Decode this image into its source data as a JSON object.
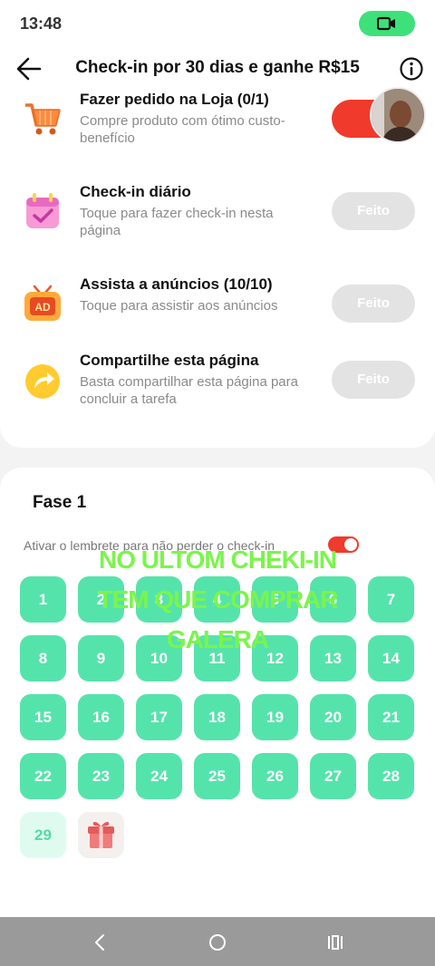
{
  "status_bar": {
    "time": "13:48",
    "record_icon": "video-camera-icon",
    "accent": "#3ee07a"
  },
  "header": {
    "title": "Check-in por 30 dias e ganhe R$15",
    "back_icon": "arrow-left-icon",
    "info_icon": "info-icon"
  },
  "tasks": [
    {
      "title": "Fazer pedido na Loja  (0/1)",
      "desc": "Compre produto com ótimo custo-benefício",
      "icon": "shopping-cart-icon",
      "button": "",
      "button_color": "#f03a2c"
    },
    {
      "title": "Check-in diário",
      "desc": "Toque para fazer check-in nesta página",
      "icon": "calendar-check-icon",
      "button": "Feito"
    },
    {
      "title": "Assista a anúncios  (10/10)",
      "desc": "Toque para assistir aos anúncios",
      "icon": "tv-ad-icon",
      "button": "Feito"
    },
    {
      "title": "Compartilhe esta página",
      "desc": "Basta compartilhar esta página para concluir a tarefa",
      "icon": "share-arrow-icon",
      "button": "Feito"
    }
  ],
  "phase": {
    "title": "Fase 1",
    "reminder_text": "Ativar o lembrete para não perder o check-in",
    "reminder_on": true,
    "days": [
      "1",
      "2",
      "3",
      "4",
      "5",
      "6",
      "7",
      "8",
      "9",
      "10",
      "11",
      "12",
      "13",
      "14",
      "15",
      "16",
      "17",
      "18",
      "19",
      "20",
      "21",
      "22",
      "23",
      "24",
      "25",
      "26",
      "27",
      "28",
      "29"
    ],
    "current_day": "29",
    "gift_icon": "gift-icon",
    "day_color": "#55e3ac"
  },
  "overlay": {
    "line1": "NO ULTOM CHEKI-IN",
    "line2": "TEM QUE COMPRAR",
    "line3": "GALERA",
    "color": "#7af54a"
  },
  "nav": {
    "back_icon": "nav-back-icon",
    "home_icon": "nav-home-icon",
    "recents_icon": "nav-recents-icon"
  }
}
